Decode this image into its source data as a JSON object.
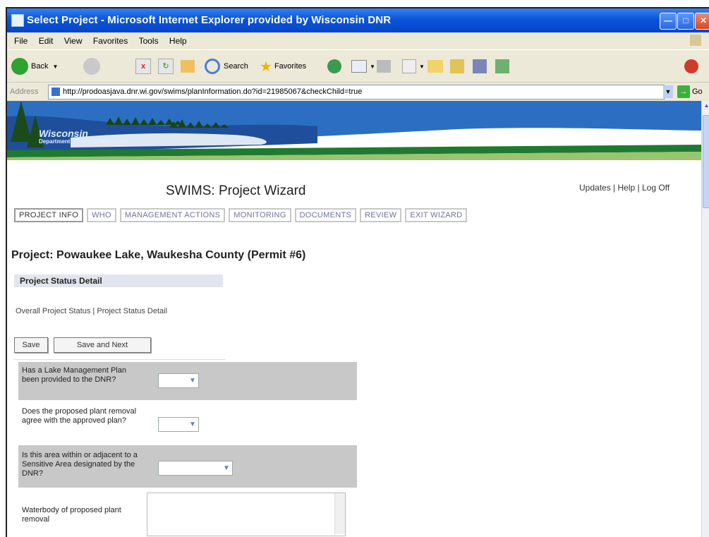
{
  "window": {
    "title": "Select Project - Microsoft Internet Explorer provided by Wisconsin DNR"
  },
  "menu": [
    "File",
    "Edit",
    "View",
    "Favorites",
    "Tools",
    "Help"
  ],
  "toolbar": {
    "back": "Back",
    "search": "Search",
    "favorites": "Favorites"
  },
  "address": {
    "label": "Address",
    "url": "http://prodoasjava.dnr.wi.gov/swims/planInformation.do?id=21985067&checkChild=true",
    "go": "Go"
  },
  "banner": {
    "state": "Wisconsin",
    "dept": "Department of Natural Resources"
  },
  "page": {
    "title": "SWIMS: Project Wizard",
    "links": [
      "Updates",
      "Help",
      "Log Off"
    ],
    "tabs": [
      "PROJECT INFO",
      "WHO",
      "MANAGEMENT ACTIONS",
      "MONITORING",
      "DOCUMENTS",
      "REVIEW",
      "EXIT WIZARD"
    ],
    "project": "Project: Powaukee Lake, Waukesha County (Permit #6)",
    "section": "Project Status Detail",
    "sublinks": [
      "Overall Project Status",
      "Project Status Detail"
    ],
    "buttons": {
      "save": "Save",
      "save_next": "Save and Next"
    },
    "questions": [
      "Has a Lake Management Plan been provided to the DNR?",
      "Does the proposed plant removal agree with the approved plan?",
      "Is this area within or adjacent to a Sensitive Area designated by the DNR?",
      "Waterbody of proposed plant removal"
    ]
  }
}
